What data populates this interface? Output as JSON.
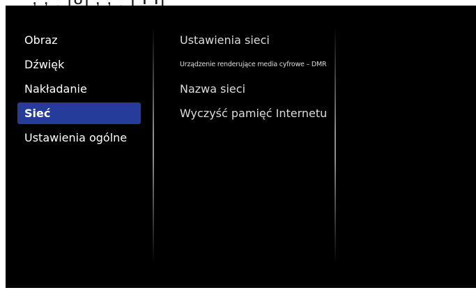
{
  "main_menu": {
    "items": [
      {
        "label": "Obraz",
        "selected": false
      },
      {
        "label": "Dźwięk",
        "selected": false
      },
      {
        "label": "Nakładanie",
        "selected": false
      },
      {
        "label": "Sieć",
        "selected": true
      },
      {
        "label": "Ustawienia ogólne",
        "selected": false
      }
    ]
  },
  "sub_menu": {
    "items": [
      {
        "label": "Ustawienia sieci"
      },
      {
        "label": "Urządzenie renderujące media cyfrowe – DMR"
      },
      {
        "label": "Nazwa sieci"
      },
      {
        "label": "Wyczyść pamięć Internetu"
      }
    ]
  },
  "colors": {
    "screen_background": "#000000",
    "selection_highlight": "#263c9a",
    "text": "#ffffff"
  }
}
